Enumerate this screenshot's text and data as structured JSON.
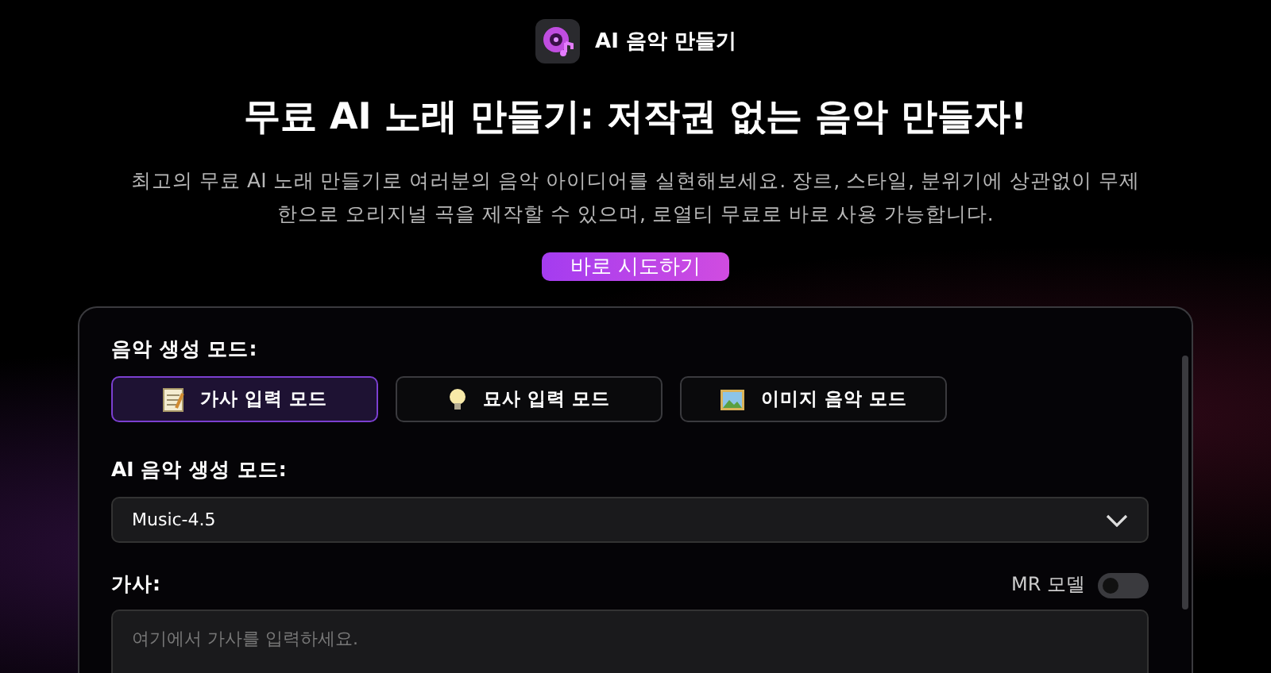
{
  "header": {
    "app_name": "AI 음악 만들기"
  },
  "hero": {
    "title": "무료 AI 노래 만들기: 저작권 없는 음악 만들자!",
    "description": "최고의 무료 AI 노래 만들기로 여러분의 음악 아이디어를 실현해보세요. 장르, 스타일, 분위기에 상관없이 무제한으로 오리지널 곡을 제작할 수 있으며, 로열티 무료로 바로 사용 가능합니다.",
    "cta": "바로 시도하기"
  },
  "form": {
    "mode_label": "음악 생성 모드:",
    "modes": [
      {
        "kind": "lyrics",
        "label": "가사 입력 모드",
        "selected": true
      },
      {
        "kind": "description",
        "label": "묘사 입력 모드",
        "selected": false
      },
      {
        "kind": "image",
        "label": "이미지 음악 모드",
        "selected": false
      }
    ],
    "model_label": "AI 음악 생성 모드:",
    "model_value": "Music-4.5",
    "lyrics_label": "가사:",
    "mr_label": "MR 모델",
    "mr_on": false,
    "lyrics_placeholder": "여기에서 가사를 입력하세요."
  }
}
